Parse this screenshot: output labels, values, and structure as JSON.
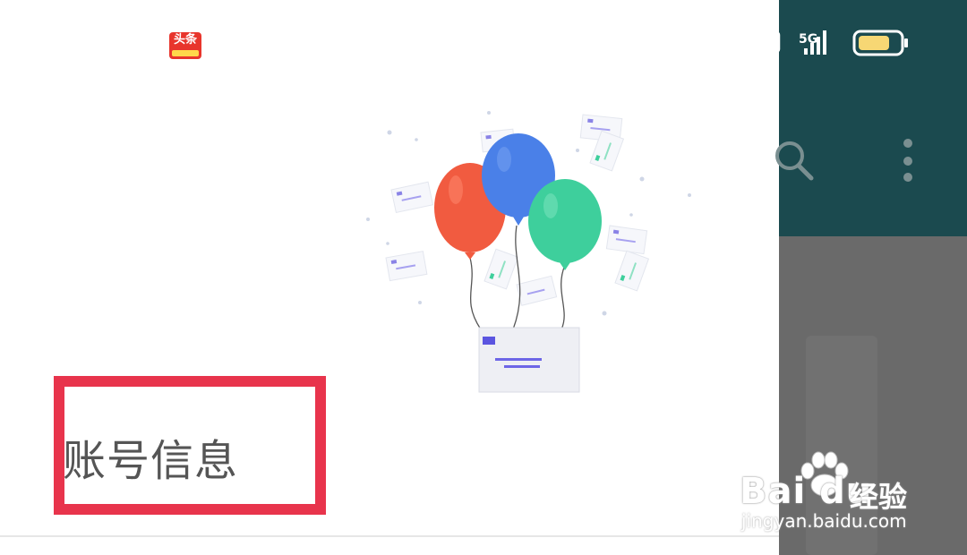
{
  "app_badge": {
    "label": "头条"
  },
  "status_bar": {
    "network": "5G",
    "battery_color": "#f7d774"
  },
  "drawer": {
    "account_info_label": "账号信息"
  },
  "toolbar": {
    "search_icon": "search-icon",
    "more_icon": "more-vertical-icon"
  },
  "watermark": {
    "brand": "Bai du",
    "experience": "经验",
    "url": "jingyan.baidu.com"
  },
  "colors": {
    "highlight": "#e8344c",
    "topbar": "#1b4a4f",
    "balloon_red": "#f15b40",
    "balloon_blue": "#4a80e8",
    "balloon_green": "#3ecf9c"
  }
}
